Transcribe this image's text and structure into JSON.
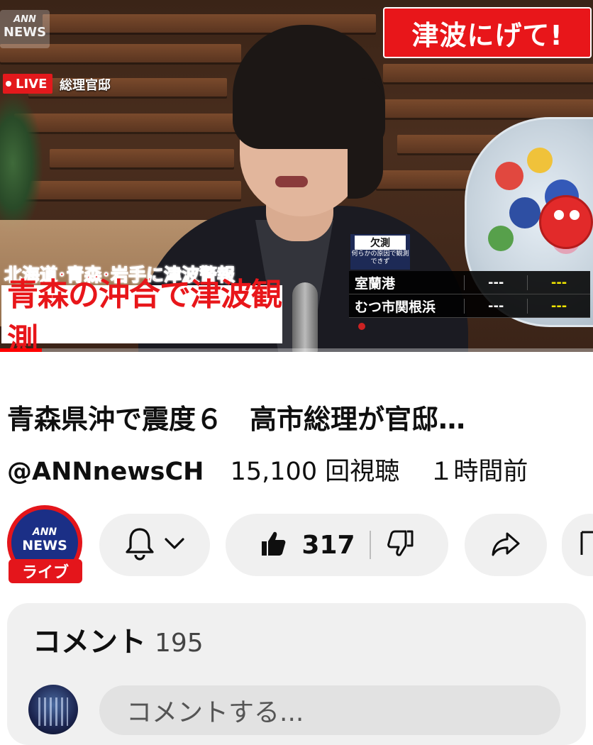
{
  "video": {
    "logo_small": "ANN",
    "logo_large": "NEWS",
    "live_label": "LIVE",
    "location": "総理官邸",
    "alert": "津波にげて!",
    "headline_top": "北海道･青森･岩手に津波警報",
    "headline_main": "青森の沖合で津波観測",
    "observation_tag": {
      "title": "欠測",
      "note": "何らかの原因で観測できず"
    },
    "observations": [
      {
        "name": "室蘭港",
        "value1": "---",
        "value2": "---"
      },
      {
        "name": "むつ市関根浜",
        "value1": "---",
        "value2": "---"
      }
    ],
    "progress": 0.07
  },
  "title": "青森県沖で震度６　高市総理が官邸…",
  "channel": "@ANNnewsCH",
  "views": "15,100 回視聴",
  "age": "１時間前",
  "avatar": {
    "small": "ANN",
    "large": "NEWS",
    "badge": "ライブ"
  },
  "actions": {
    "like_count": "317"
  },
  "icons": {
    "bell": "bell-icon",
    "chevron": "chevron-down-icon",
    "like": "thumbs-up-icon",
    "dislike": "thumbs-down-icon",
    "share": "share-icon",
    "save": "save-icon"
  },
  "comments": {
    "label": "コメント",
    "count": "195",
    "placeholder": "コメントする..."
  },
  "colors": {
    "accent_red": "#e8161a",
    "pill_bg": "#f0f0f0",
    "ticker_yellow": "#f2e600"
  }
}
